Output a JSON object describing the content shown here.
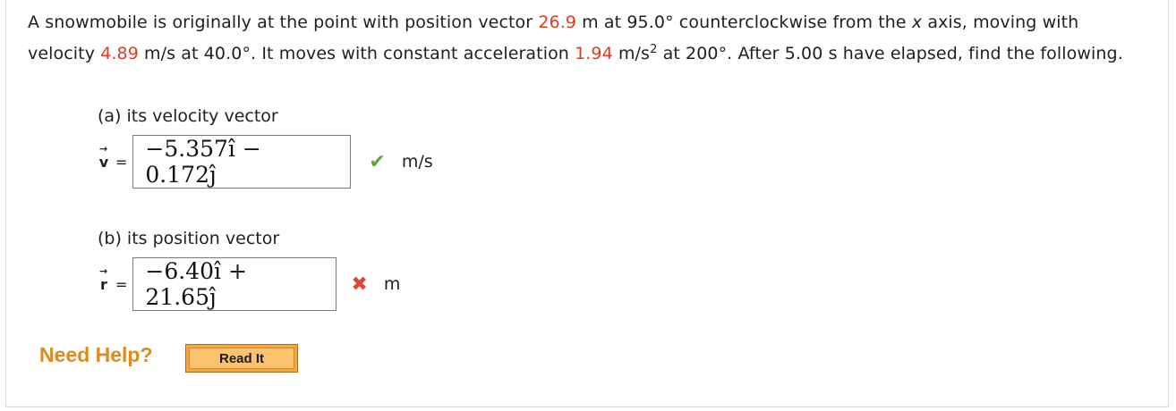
{
  "question": {
    "text_1": "A snowmobile is originally at the point with position vector ",
    "pos_mag": "26.9",
    "text_2": " m at 95.0° counterclockwise from the ",
    "axis_var": "x",
    "text_3": " axis, moving with velocity ",
    "vel_mag": "4.89",
    "text_4": " m/s at 40.0°. It moves with constant acceleration ",
    "acc_mag": "1.94",
    "text_5": " m/s",
    "acc_exp": "2",
    "text_6": " at 200°. After 5.00 s have elapsed, find the following."
  },
  "part_a": {
    "label": "(a) its velocity vector",
    "symbol": "v",
    "arrow": "→",
    "equals": "=",
    "answer": "−5.357î − 0.172ĵ",
    "status_icon": "checkmark-icon",
    "status_glyph": "✔",
    "unit": "m/s"
  },
  "part_b": {
    "label": "(b) its position vector",
    "symbol": "r",
    "arrow": "→",
    "equals": "=",
    "answer": "−6.40î + 21.65ĵ",
    "status_icon": "cross-icon",
    "status_glyph": "✖",
    "unit": "m"
  },
  "help": {
    "label": "Need Help?",
    "read_it": "Read It"
  },
  "colors": {
    "highlight": "#e23a1f",
    "correct": "#5aa63a",
    "incorrect": "#e0453a",
    "help": "#e08a1e"
  }
}
